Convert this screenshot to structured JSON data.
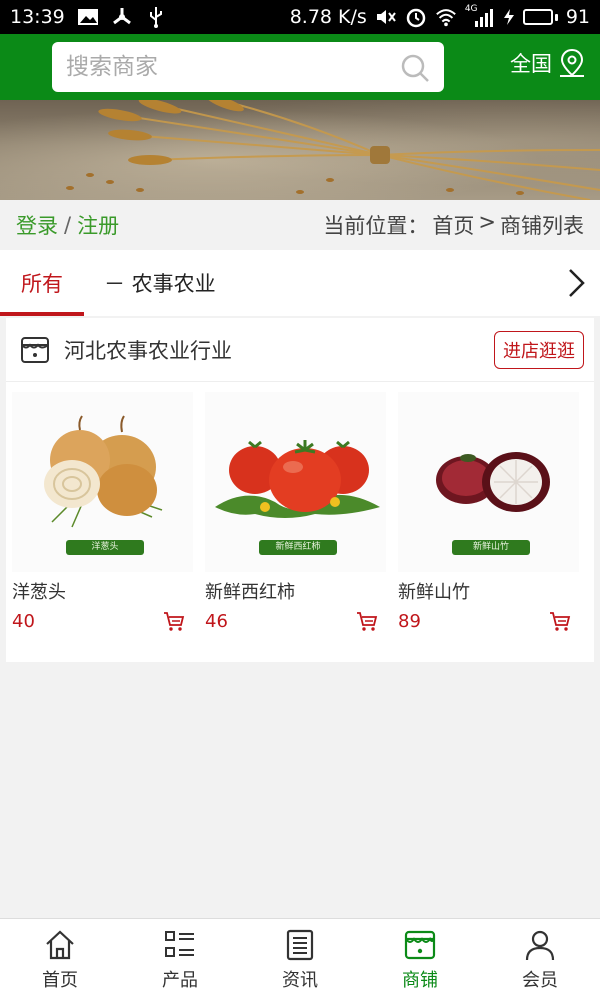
{
  "status_bar": {
    "time": "13:39",
    "speed": "8.78 K/s",
    "network": "4G",
    "battery_level": "91",
    "battery_fraction": 0.91
  },
  "header": {
    "search_placeholder": "搜索商家",
    "region": "全国"
  },
  "breadcrumb": {
    "login": "登录",
    "separator": "/",
    "register": "注册",
    "location_label": "当前位置：",
    "home": "首页",
    "arrow": ">",
    "current": "商铺列表"
  },
  "tabs": {
    "all": "所有",
    "category": "－ 农事农业"
  },
  "shop": {
    "name": "河北农事农业行业",
    "visit_button": "进店逛逛",
    "products": [
      {
        "title": "洋葱头",
        "price": "40",
        "tag": "洋葱头"
      },
      {
        "title": "新鲜西红柿",
        "price": "46",
        "tag": "新鲜西红柿"
      },
      {
        "title": "新鲜山竹",
        "price": "89",
        "tag": "新鲜山竹"
      }
    ]
  },
  "bottom_nav": {
    "items": [
      {
        "label": "首页",
        "icon": "home-icon"
      },
      {
        "label": "产品",
        "icon": "list-icon"
      },
      {
        "label": "资讯",
        "icon": "news-icon"
      },
      {
        "label": "商铺",
        "icon": "store-icon"
      },
      {
        "label": "会员",
        "icon": "user-icon"
      }
    ],
    "active": "商铺"
  },
  "colors": {
    "brand_green": "#0b8a17",
    "accent_red": "#c0161b",
    "link_green": "#3a9a2a"
  }
}
